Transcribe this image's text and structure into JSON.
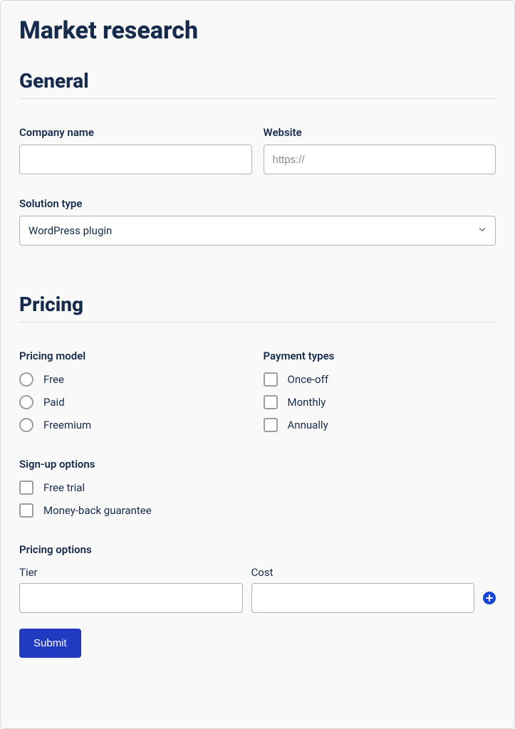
{
  "title": "Market research",
  "sections": {
    "general": {
      "heading": "General",
      "company_name": {
        "label": "Company name",
        "value": ""
      },
      "website": {
        "label": "Website",
        "placeholder": "https://",
        "value": ""
      },
      "solution_type": {
        "label": "Solution type",
        "selected": "WordPress plugin"
      }
    },
    "pricing": {
      "heading": "Pricing",
      "pricing_model": {
        "label": "Pricing model",
        "options": [
          "Free",
          "Paid",
          "Freemium"
        ]
      },
      "payment_types": {
        "label": "Payment types",
        "options": [
          "Once-off",
          "Monthly",
          "Annually"
        ]
      },
      "signup_options": {
        "label": "Sign-up options",
        "options": [
          "Free trial",
          "Money-back guarantee"
        ]
      },
      "pricing_options": {
        "label": "Pricing options",
        "tier": {
          "label": "Tier",
          "value": ""
        },
        "cost": {
          "label": "Cost",
          "value": ""
        }
      }
    }
  },
  "submit_label": "Submit"
}
